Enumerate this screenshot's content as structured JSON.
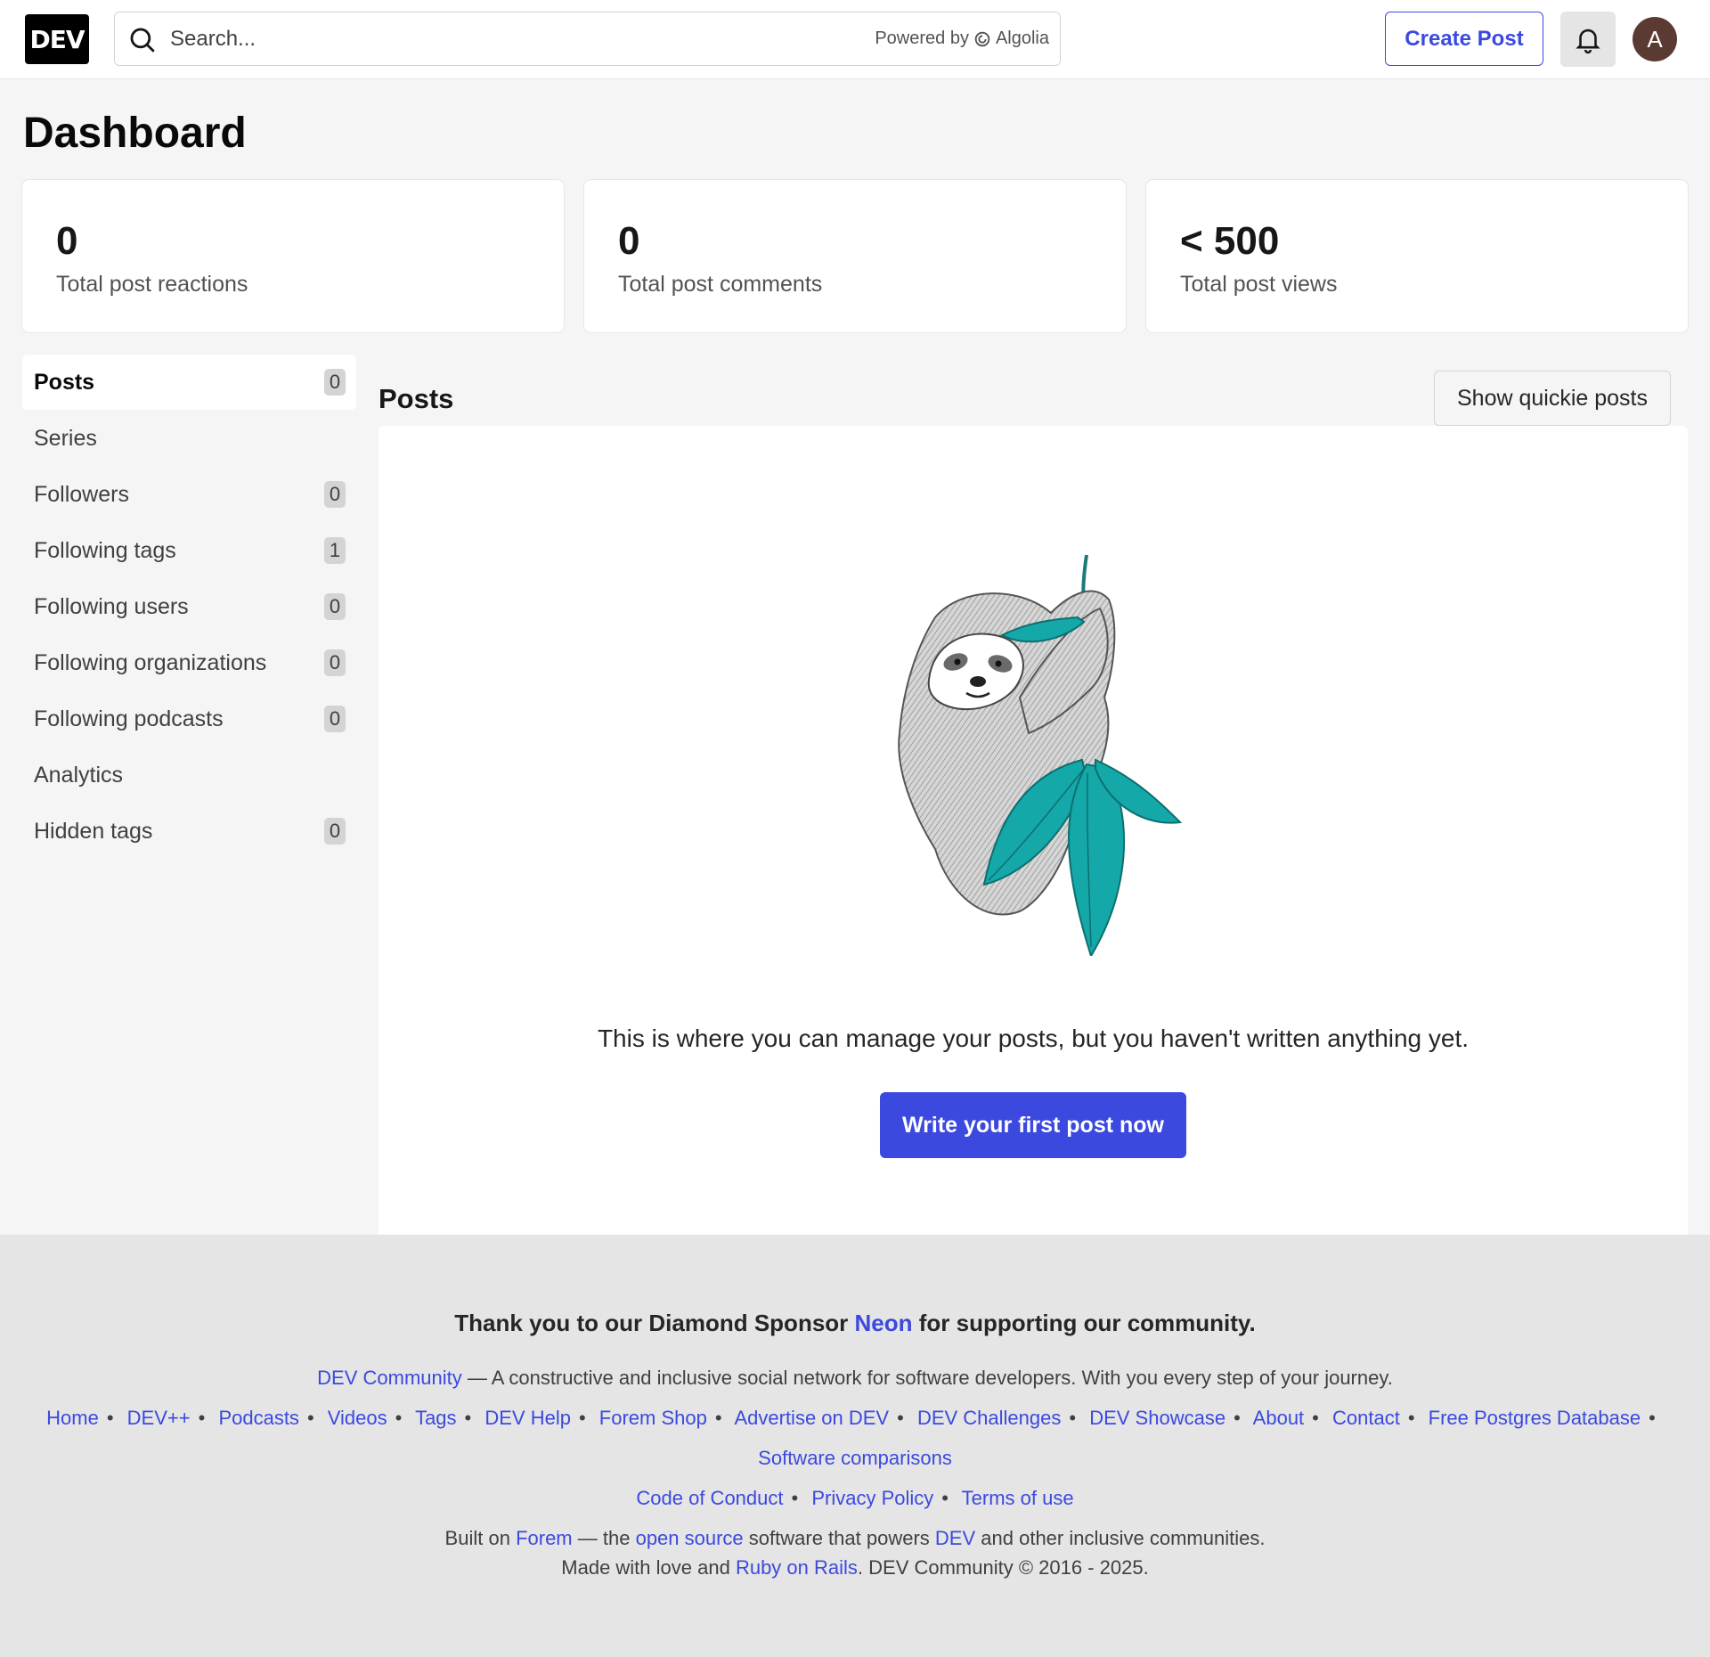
{
  "header": {
    "logo": "DEV",
    "search_placeholder": "Search...",
    "powered_by": "Powered by",
    "algolia": "Algolia",
    "create_post": "Create Post",
    "avatar_initial": "A"
  },
  "page_title": "Dashboard",
  "stats": [
    {
      "value": "0",
      "label": "Total post reactions"
    },
    {
      "value": "0",
      "label": "Total post comments"
    },
    {
      "value": "< 500",
      "label": "Total post views"
    }
  ],
  "sidebar": {
    "items": [
      {
        "label": "Posts",
        "count": "0"
      },
      {
        "label": "Series",
        "count": ""
      },
      {
        "label": "Followers",
        "count": "0"
      },
      {
        "label": "Following tags",
        "count": "1"
      },
      {
        "label": "Following users",
        "count": "0"
      },
      {
        "label": "Following organizations",
        "count": "0"
      },
      {
        "label": "Following podcasts",
        "count": "0"
      },
      {
        "label": "Analytics",
        "count": ""
      },
      {
        "label": "Hidden tags",
        "count": "0"
      }
    ]
  },
  "posts": {
    "title": "Posts",
    "show_quickie": "Show quickie posts",
    "empty_text": "This is where you can manage your posts, but you haven't written anything yet.",
    "write_button": "Write your first post now"
  },
  "footer": {
    "sponsor_pre": "Thank you to our Diamond Sponsor",
    "sponsor_name": "Neon",
    "sponsor_post": "for supporting our community.",
    "community_link": "DEV Community",
    "tagline": "— A constructive and inclusive social network for software developers. With you every step of your journey.",
    "nav": [
      "Home",
      "DEV++",
      "Podcasts",
      "Videos",
      "Tags",
      "DEV Help",
      "Forem Shop",
      "Advertise on DEV",
      "DEV Challenges",
      "DEV Showcase",
      "About",
      "Contact",
      "Free Postgres Database"
    ],
    "nav2": [
      "Software comparisons"
    ],
    "legal": [
      "Code of Conduct",
      "Privacy Policy",
      "Terms of use"
    ],
    "built_1": "Built on",
    "forem": "Forem",
    "built_2": "— the",
    "open_source": "open source",
    "built_3": "software that powers",
    "dev": "DEV",
    "built_4": "and other inclusive communities.",
    "made_1": "Made with love and",
    "rails": "Ruby on Rails",
    "made_2": ". DEV Community © 2016 - 2025."
  },
  "colors": {
    "accent": "#3b49df",
    "leaf": "#14a8a8",
    "avatar": "#5b3a33"
  }
}
